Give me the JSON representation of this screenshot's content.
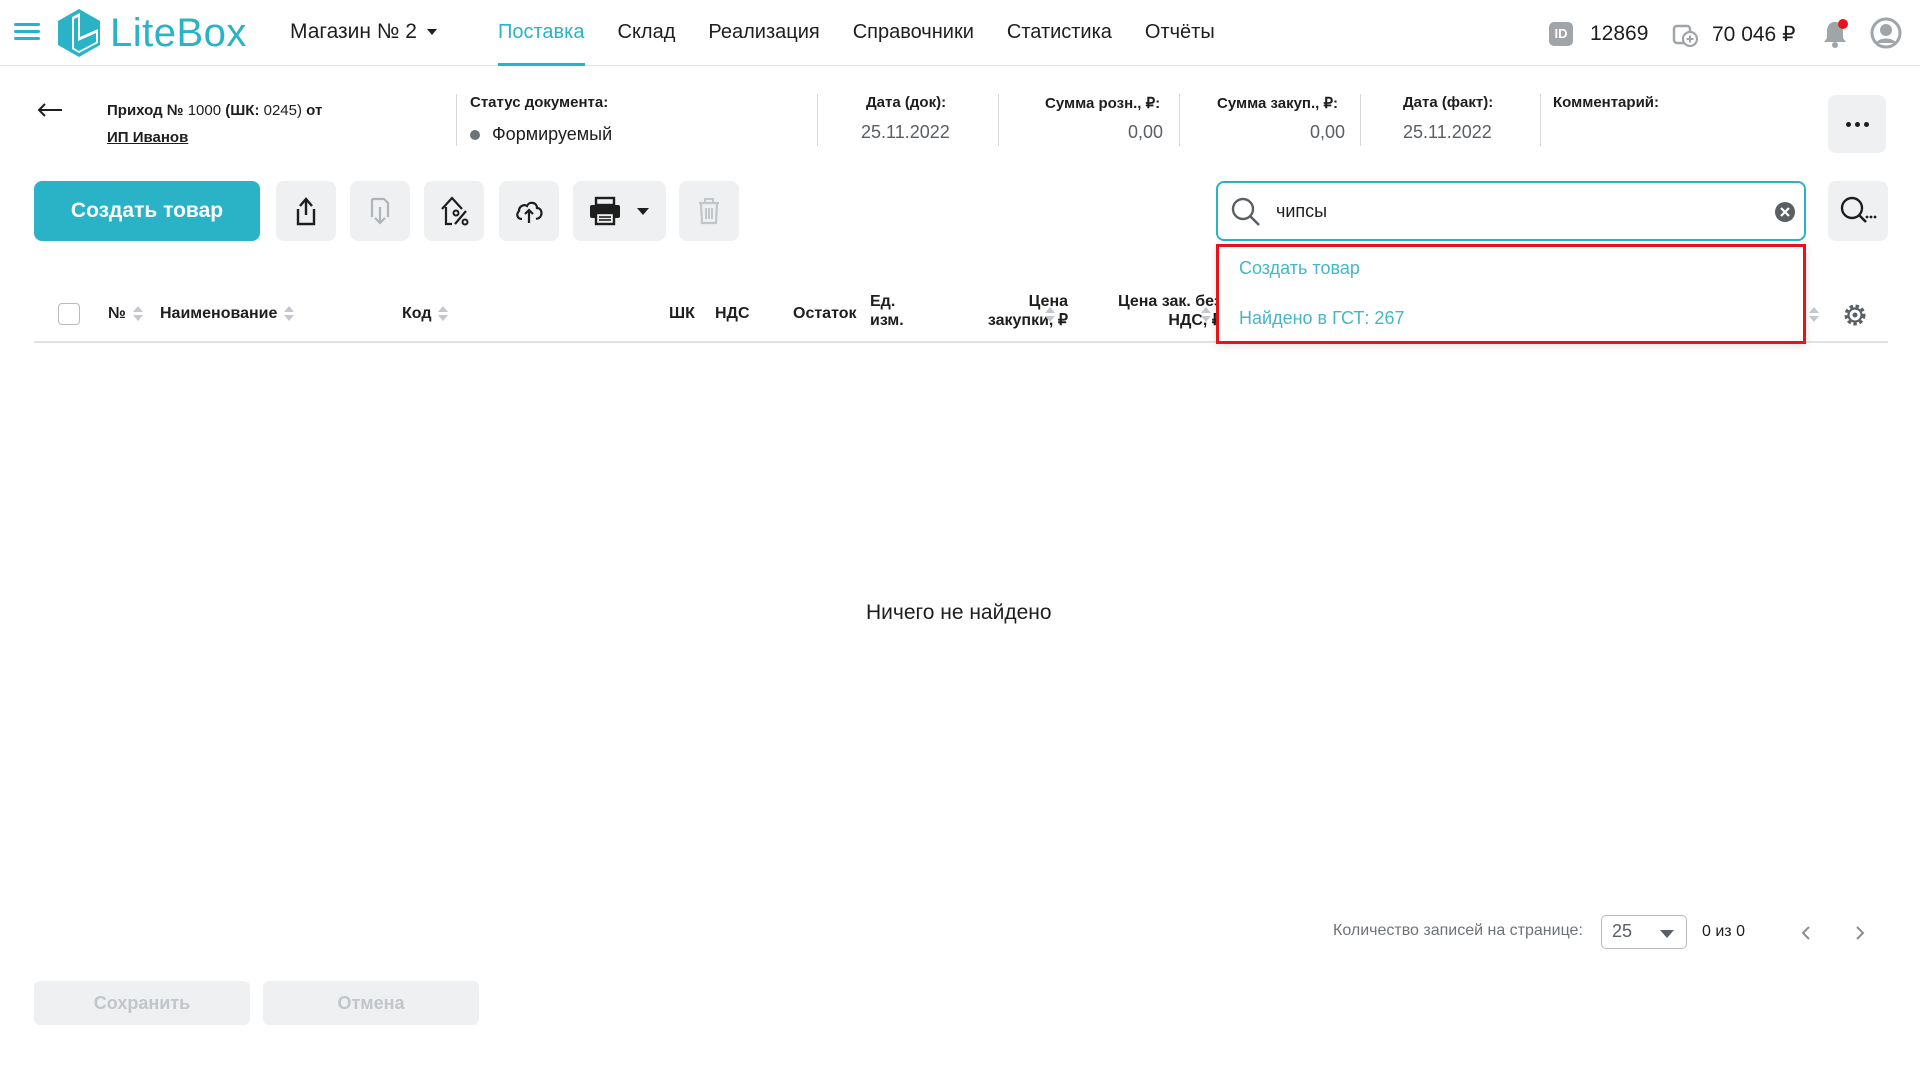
{
  "header": {
    "logo_text": "LiteBox",
    "store_name": "Магазин № 2",
    "nav": [
      {
        "label": "Поставка",
        "active": true
      },
      {
        "label": "Склад",
        "active": false
      },
      {
        "label": "Реализация",
        "active": false
      },
      {
        "label": "Справочники",
        "active": false
      },
      {
        "label": "Статистика",
        "active": false
      },
      {
        "label": "Отчёты",
        "active": false
      }
    ],
    "id_icon_text": "ID",
    "account_id": "12869",
    "balance": "70 046 ₽",
    "accent_color": "#2ab3c7"
  },
  "document": {
    "title_prefix": "Приход №",
    "number": "1000",
    "barcode_part": "(ШК:",
    "barcode": "0245)",
    "from_label": "от",
    "supplier": "ИП Иванов",
    "status_label": "Статус документа:",
    "status_value": "Формируемый",
    "date_doc_label": "Дата (док):",
    "date_doc_value": "25.11.2022",
    "retail_sum_label": "Сумма розн., ₽:",
    "retail_sum_value": "0,00",
    "purchase_sum_label": "Сумма закуп., ₽:",
    "purchase_sum_value": "0,00",
    "date_fact_label": "Дата (факт):",
    "date_fact_value": "25.11.2022",
    "comment_label": "Комментарий:"
  },
  "toolbar": {
    "create_label": "Создать товар",
    "icons": [
      "upload-icon",
      "download-icon",
      "price-percent-icon",
      "cloud-upload-icon",
      "printer-icon",
      "trash-icon"
    ]
  },
  "search": {
    "value": "чипсы",
    "dropdown": [
      "Создать товар",
      "Найдено в ГСТ: 267"
    ]
  },
  "table": {
    "columns": [
      "№",
      "Наименование",
      "Код",
      "ШК",
      "НДС",
      "Остаток",
      "Ед. изм.",
      "Цена закупки, ₽",
      "Цена зак. без НДС, ₽"
    ],
    "col_unit_1": "Ед.",
    "col_unit_2": "изм.",
    "col_price_1": "Цена",
    "col_price_2": "закупки, ₽",
    "col_price_nv_1": "Цена зак. без",
    "col_price_nv_2": "НДС, ₽",
    "empty_message": "Ничего не найдено"
  },
  "pagination": {
    "per_page_label": "Количество записей на странице:",
    "per_page_value": "25",
    "count_text": "0 из 0"
  },
  "footer": {
    "save_label": "Сохранить",
    "cancel_label": "Отмена"
  }
}
